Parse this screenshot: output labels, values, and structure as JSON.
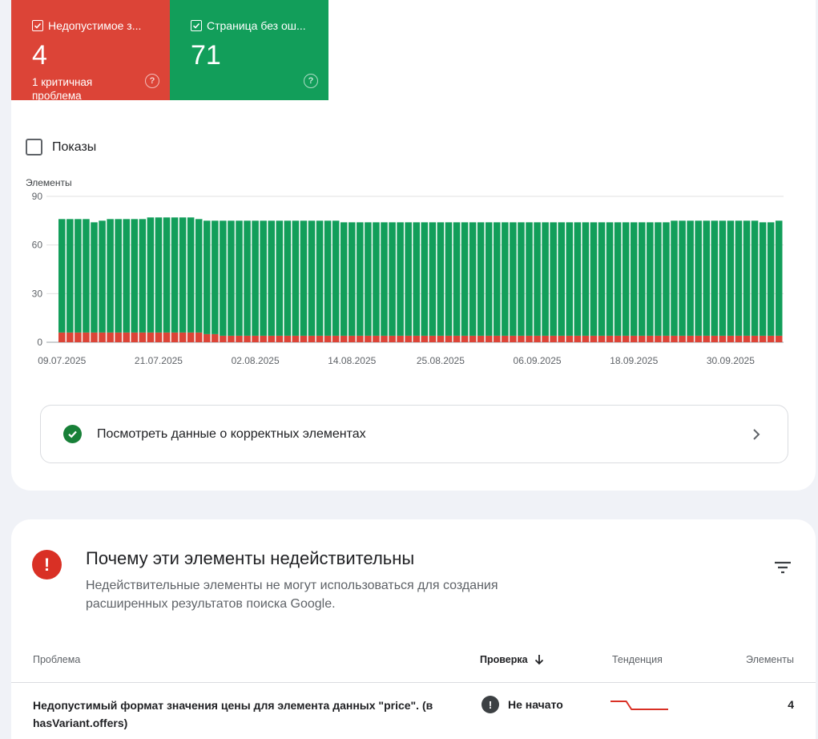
{
  "summary": {
    "invalid": {
      "label": "Недопустимое з...",
      "count": "4",
      "note": "1 критичная проблема",
      "color": "#dc4437"
    },
    "valid": {
      "label": "Страница без ош...",
      "count": "71",
      "color": "#129e5a"
    }
  },
  "impressions_toggle": {
    "label": "Показы",
    "checked": false
  },
  "chart_data": {
    "type": "bar",
    "stacked": true,
    "ylabel": "Элементы",
    "ylim": [
      0,
      90
    ],
    "yticks": [
      0,
      30,
      60,
      90
    ],
    "xtick_labels": [
      "09.07.2025",
      "21.07.2025",
      "02.08.2025",
      "14.08.2025",
      "25.08.2025",
      "06.09.2025",
      "18.09.2025",
      "30.09.2025"
    ],
    "xtick_indices": [
      0,
      12,
      24,
      36,
      47,
      59,
      71,
      83
    ],
    "series": [
      {
        "color": "#dc4437",
        "values": [
          6,
          6,
          6,
          6,
          6,
          6,
          6,
          6,
          6,
          6,
          6,
          6,
          6,
          6,
          6,
          6,
          6,
          6,
          5,
          5,
          4,
          4,
          4,
          4,
          4,
          4,
          4,
          4,
          4,
          4,
          4,
          4,
          4,
          4,
          4,
          4,
          4,
          4,
          4,
          4,
          4,
          4,
          4,
          4,
          4,
          4,
          4,
          4,
          4,
          4,
          4,
          4,
          4,
          4,
          4,
          4,
          4,
          4,
          4,
          4,
          4,
          4,
          4,
          4,
          4,
          4,
          4,
          4,
          4,
          4,
          4,
          4,
          4,
          4,
          4,
          4,
          4,
          4,
          4,
          4,
          4,
          4,
          4,
          4,
          4,
          4,
          4,
          4,
          4,
          4
        ]
      },
      {
        "color": "#129e5a",
        "values": [
          70,
          70,
          70,
          70,
          68,
          69,
          70,
          70,
          70,
          70,
          70,
          71,
          71,
          71,
          71,
          71,
          71,
          70,
          70,
          70,
          71,
          71,
          71,
          71,
          71,
          71,
          71,
          71,
          71,
          71,
          71,
          71,
          71,
          71,
          71,
          70,
          70,
          70,
          70,
          70,
          70,
          70,
          70,
          70,
          70,
          70,
          70,
          70,
          70,
          70,
          70,
          70,
          70,
          70,
          70,
          70,
          70,
          70,
          70,
          70,
          70,
          70,
          70,
          70,
          70,
          70,
          70,
          70,
          70,
          70,
          70,
          70,
          70,
          70,
          70,
          70,
          71,
          71,
          71,
          71,
          71,
          71,
          71,
          71,
          71,
          71,
          71,
          70,
          70,
          71
        ]
      }
    ]
  },
  "view_valid": {
    "label": "Посмотреть данные о корректных элементах"
  },
  "issues_section": {
    "title": "Почему эти элементы недействительны",
    "description": "Недействительные элементы не могут использоваться для создания расширенных результатов поиска Google.",
    "columns": {
      "issue": "Проблема",
      "validation": "Проверка",
      "trend": "Тенденция",
      "items": "Элементы"
    },
    "rows": [
      {
        "issue": "Недопустимый формат значения цены для элемента данных \"price\". (в hasVariant.offers)",
        "status": "Не начато",
        "count": "4",
        "trend": [
          6,
          6,
          6,
          6,
          6,
          6,
          6,
          5,
          4,
          4,
          4,
          4,
          4,
          4,
          4,
          4,
          4,
          4,
          4,
          4,
          4,
          4,
          4
        ]
      }
    ]
  },
  "icons": {
    "checkbox": "check-icon",
    "help": "help-circle-icon",
    "ok": "check-circle-icon",
    "chevron": "chevron-right-icon",
    "error": "exclamation-circle-icon",
    "filter": "filter-icon",
    "sort": "arrow-down-icon"
  }
}
